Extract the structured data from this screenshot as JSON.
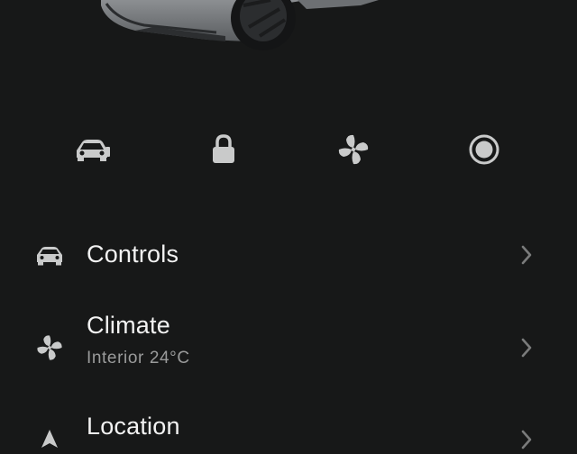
{
  "header": {
    "vehicle_image": "car-front-icon"
  },
  "quick_actions": [
    {
      "name": "car-icon"
    },
    {
      "name": "lock-icon"
    },
    {
      "name": "fan-icon"
    },
    {
      "name": "record-icon"
    }
  ],
  "menu": {
    "controls": {
      "title": "Controls",
      "icon": "car-icon"
    },
    "climate": {
      "title": "Climate",
      "subtitle": "Interior 24°C",
      "icon": "fan-icon"
    },
    "location": {
      "title": "Location",
      "icon": "navigation-arrow-icon"
    }
  },
  "colors": {
    "background": "#171818",
    "icon": "#c9caca",
    "title": "#f2f2f2",
    "subtitle": "#9a9b9b",
    "chevron": "#7a7b7b"
  }
}
